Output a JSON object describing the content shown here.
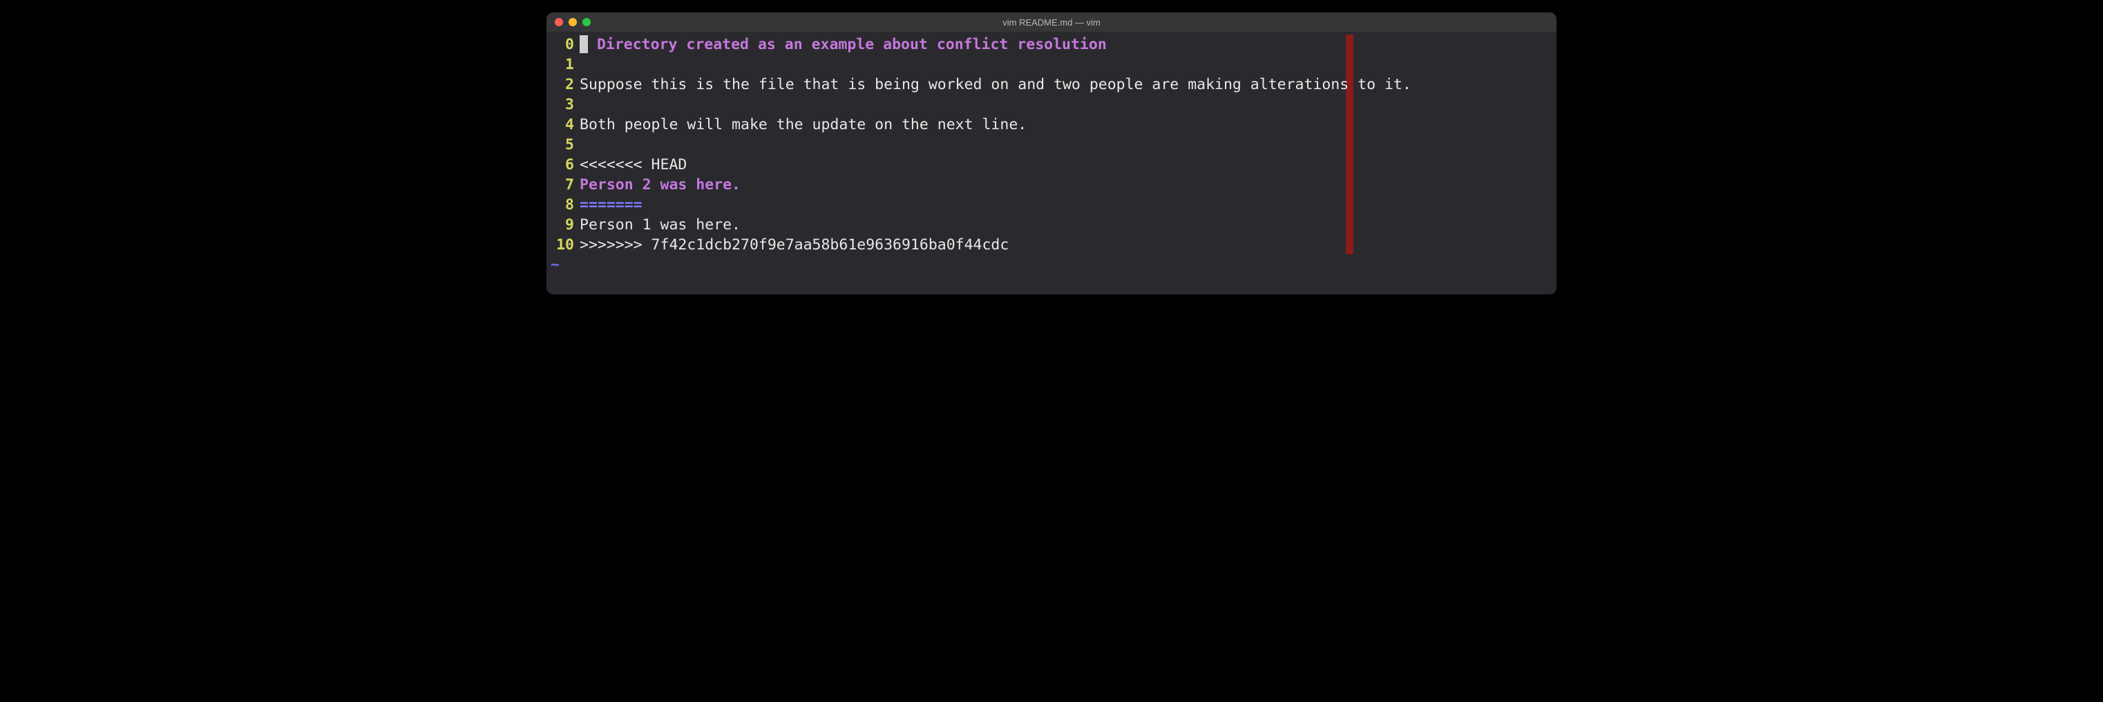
{
  "window": {
    "title": "vim README.md — vim"
  },
  "editor": {
    "lines": [
      {
        "number": "0",
        "type": "heading",
        "hash": "#",
        "heading_text": " Directory created as an example about conflict resolution",
        "has_cursor": true
      },
      {
        "number": "1",
        "type": "blank",
        "text": ""
      },
      {
        "number": "2",
        "type": "text",
        "text": "Suppose this is the file that is being worked on and two people are making alterations to it."
      },
      {
        "number": "3",
        "type": "blank",
        "text": ""
      },
      {
        "number": "4",
        "type": "text",
        "text": "Both people will make the update on the next line."
      },
      {
        "number": "5",
        "type": "blank",
        "text": ""
      },
      {
        "number": "6",
        "type": "text",
        "text": "<<<<<<< HEAD"
      },
      {
        "number": "7",
        "type": "person2",
        "text": "Person 2 was here."
      },
      {
        "number": "8",
        "type": "separator",
        "text": "======="
      },
      {
        "number": "9",
        "type": "text",
        "text": "Person 1 was here."
      },
      {
        "number": "10",
        "type": "text",
        "text": ">>>>>>> 7f42c1dcb270f9e7aa58b61e9636916ba0f44cdc"
      }
    ],
    "tilde": "~"
  },
  "colors": {
    "line_number": "#d7d75f",
    "heading": "#c678dd",
    "separator": "#7c7cff",
    "color_column": "#8b1a1a",
    "background": "#2a2a2e",
    "text": "#e8e8e8"
  }
}
